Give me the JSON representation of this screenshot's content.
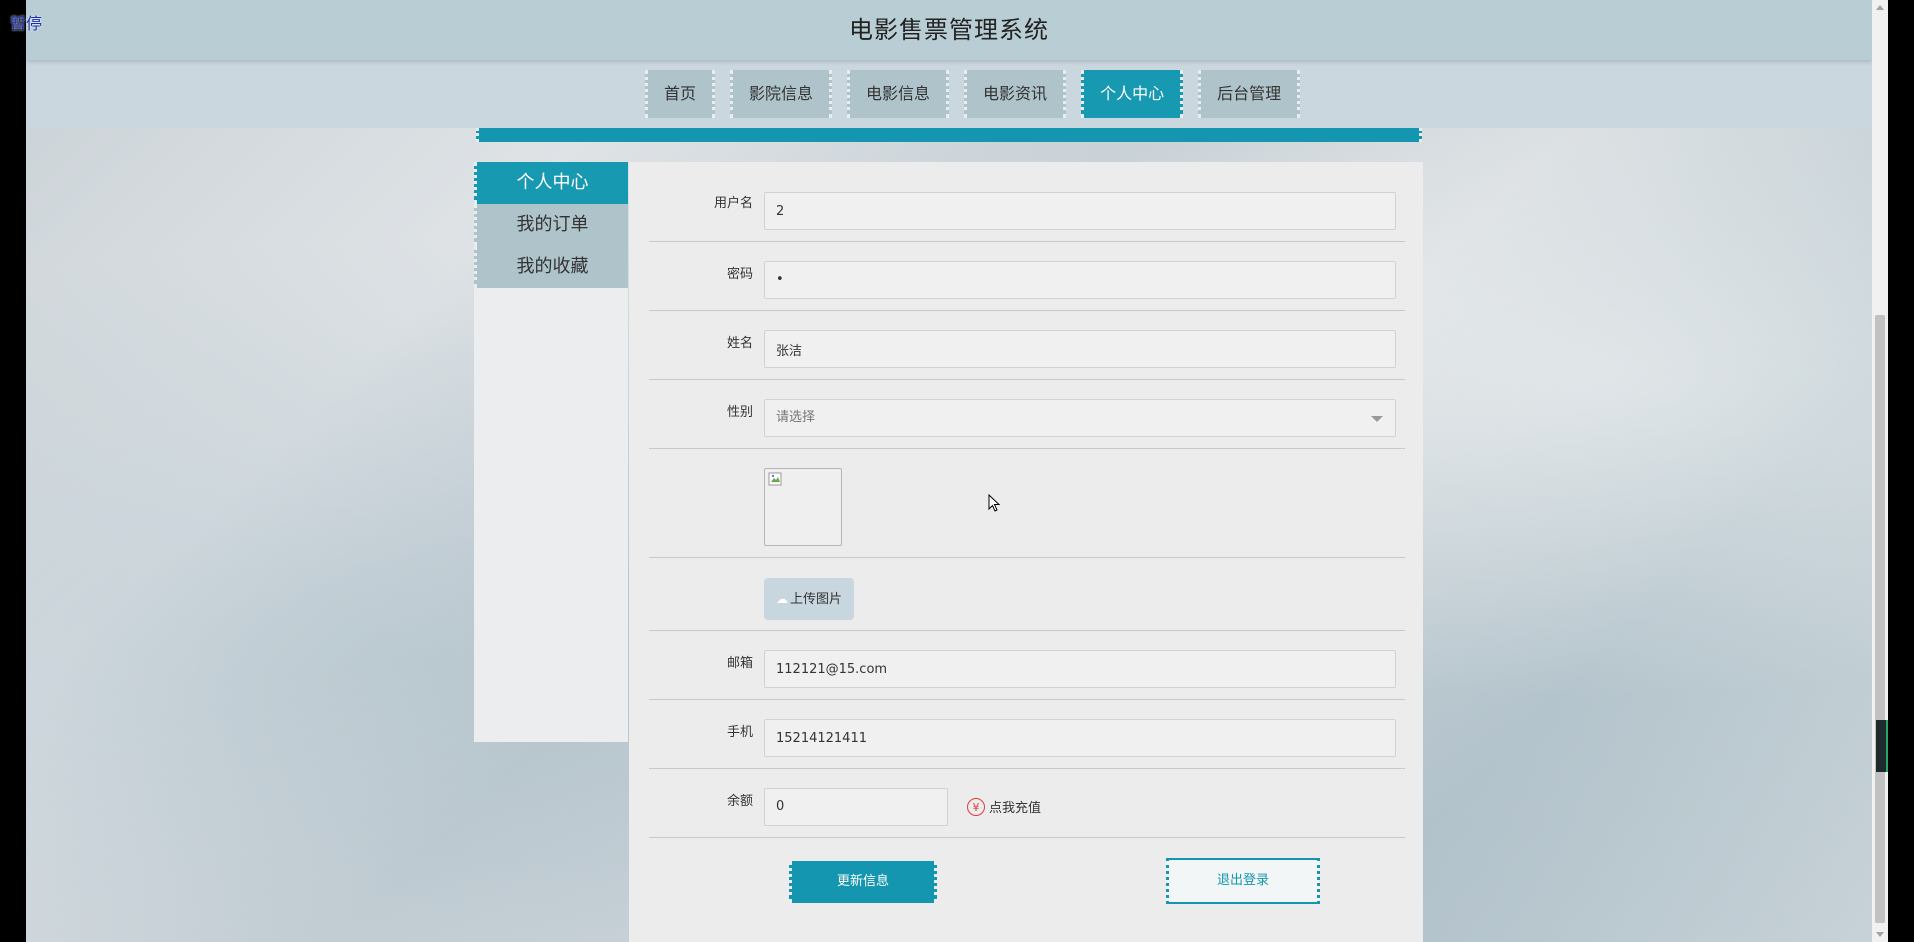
{
  "overlay": {
    "pause_label": "暂停"
  },
  "header": {
    "title": "电影售票管理系统"
  },
  "nav": {
    "items": [
      {
        "label": "首页",
        "active": false
      },
      {
        "label": "影院信息",
        "active": false
      },
      {
        "label": "电影信息",
        "active": false
      },
      {
        "label": "电影资讯",
        "active": false
      },
      {
        "label": "个人中心",
        "active": true
      },
      {
        "label": "后台管理",
        "active": false
      }
    ]
  },
  "sidebar": {
    "items": [
      {
        "label": "个人中心",
        "active": true
      },
      {
        "label": "我的订单",
        "active": false
      },
      {
        "label": "我的收藏",
        "active": false
      }
    ]
  },
  "form": {
    "username": {
      "label": "用户名",
      "value": "2"
    },
    "password": {
      "label": "密码",
      "value": "•"
    },
    "name": {
      "label": "姓名",
      "value": "张洁"
    },
    "gender": {
      "label": "性别",
      "placeholder": "请选择"
    },
    "avatar": {
      "icon": "broken-image-icon"
    },
    "upload": {
      "label": "上传图片",
      "icon": "cloud-upload-icon"
    },
    "email": {
      "label": "邮箱",
      "value": "112121@15.com"
    },
    "phone": {
      "label": "手机",
      "value": "15214121411"
    },
    "balance": {
      "label": "余额",
      "value": "0",
      "recharge_label": "点我充值",
      "recharge_icon": "¥"
    }
  },
  "actions": {
    "update_label": "更新信息",
    "logout_label": "退出登录"
  },
  "colors": {
    "accent": "#1596b0",
    "nav_bg": "#aec3ca",
    "header_bg": "#b8cdd4",
    "panel_bg": "#ececec"
  }
}
